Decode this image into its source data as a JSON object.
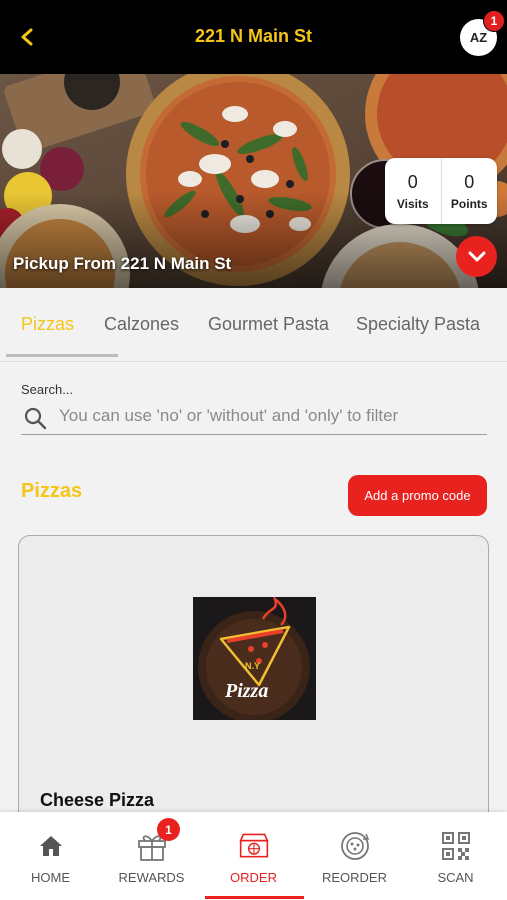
{
  "header": {
    "title": "221 N Main St",
    "avatar_initials": "AZ",
    "notification_count": "1"
  },
  "hero": {
    "stats": [
      {
        "value": "0",
        "label": "Visits"
      },
      {
        "value": "0",
        "label": "Points"
      }
    ],
    "pickup_text": "Pickup From 221 N Main St"
  },
  "tabs": [
    {
      "label": "Pizzas",
      "active": true
    },
    {
      "label": "Calzones",
      "active": false
    },
    {
      "label": "Gourmet Pasta",
      "active": false
    },
    {
      "label": "Specialty Pasta",
      "active": false
    }
  ],
  "search": {
    "label": "Search...",
    "placeholder": "You can use 'no' or 'without' and 'only' to filter",
    "value": ""
  },
  "section": {
    "title": "Pizzas",
    "promo_button": "Add a promo code"
  },
  "product": {
    "name": "Cheese Pizza",
    "logo_text_top": "N.Y",
    "logo_text_bottom": "Pizza"
  },
  "bottom_nav": {
    "items": [
      {
        "label": "HOME",
        "icon": "home-icon",
        "active": false
      },
      {
        "label": "REWARDS",
        "icon": "gift-icon",
        "active": false
      },
      {
        "label": "ORDER",
        "icon": "pizza-box-icon",
        "active": true
      },
      {
        "label": "REORDER",
        "icon": "reorder-icon",
        "active": false
      },
      {
        "label": "SCAN",
        "icon": "qr-code-icon",
        "active": false
      }
    ],
    "rewards_badge": "1"
  },
  "colors": {
    "accent_yellow": "#f5c518",
    "accent_red": "#e8221f",
    "header_bg": "#000000"
  }
}
